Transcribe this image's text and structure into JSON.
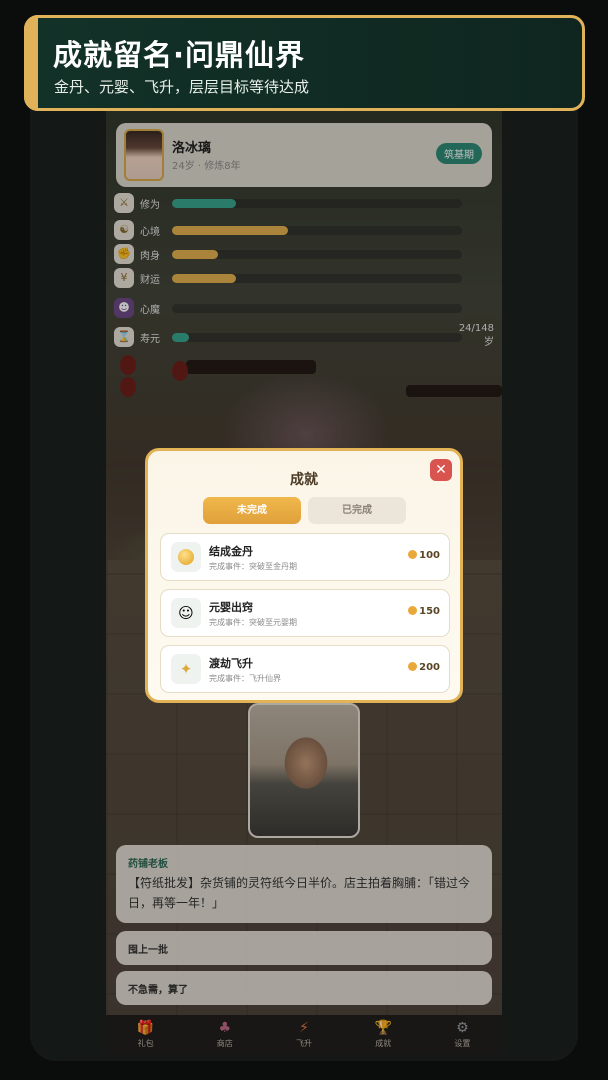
{
  "banner": {
    "title": "成就留名·问鼎仙界",
    "subtitle": "金丹、元婴、飞升，层层目标等待达成"
  },
  "player": {
    "name": "洛冰璃",
    "meta": "24岁 · 修炼8年",
    "realm": "筑基期"
  },
  "stats": [
    {
      "label": "修为",
      "icon": "cultivation-icon",
      "value": 0.22,
      "color": "#3aa58e"
    },
    {
      "label": "心境",
      "icon": "mind-icon",
      "value": 0.4,
      "color": "#e3b04e"
    },
    {
      "label": "肉身",
      "icon": "body-icon",
      "value": 0.16,
      "color": "#e3b04e"
    },
    {
      "label": "财运",
      "icon": "wealth-icon",
      "value": 0.22,
      "color": "#e3b04e"
    },
    {
      "label": "心魔",
      "icon": "demon-icon",
      "value": 0.0,
      "color": "#9b59b6"
    },
    {
      "label": "寿元",
      "icon": "lifespan-icon",
      "value": 0.06,
      "color": "#3aa58e",
      "extra": "24/148",
      "unit": "岁"
    }
  ],
  "modal": {
    "title": "成就",
    "tabs": [
      "未完成",
      "已完成"
    ],
    "active_tab": "未完成",
    "achievements": [
      {
        "name": "结成金丹",
        "desc": "完成事件：突破至金丹期",
        "reward": "100",
        "icon": "golden-core-icon"
      },
      {
        "name": "元婴出窍",
        "desc": "完成事件：突破至元婴期",
        "reward": "150",
        "icon": "nascent-soul-icon"
      },
      {
        "name": "渡劫飞升",
        "desc": "完成事件：飞升仙界",
        "reward": "200",
        "icon": "sparkle-icon"
      }
    ]
  },
  "dialog": {
    "speaker": "药铺老板",
    "text": "【符纸批发】杂货铺的灵符纸今日半价。店主拍着胸脯：「错过今日，再等一年！」"
  },
  "choices": [
    "囤上一批",
    "不急需，算了"
  ],
  "nav": [
    {
      "label": "礼包",
      "icon": "gift-icon"
    },
    {
      "label": "商店",
      "icon": "shop-icon"
    },
    {
      "label": "飞升",
      "icon": "lightning-icon"
    },
    {
      "label": "成就",
      "icon": "trophy-icon"
    },
    {
      "label": "设置",
      "icon": "gear-icon"
    }
  ],
  "colors": {
    "accent_gold": "#e0b35a",
    "banner_bg": "#123228",
    "close_red": "#d9534f",
    "realm_green": "#2f8a77"
  }
}
